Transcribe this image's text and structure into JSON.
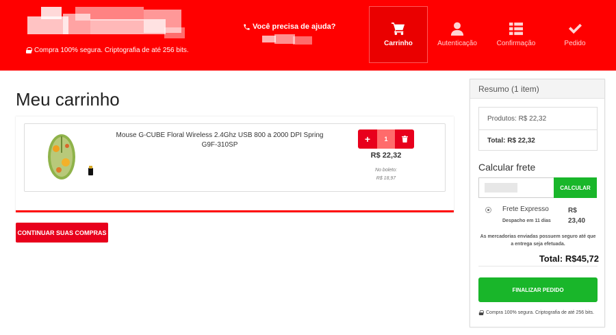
{
  "header": {
    "secure_text": "Compra 100% segura. Criptografia de até 256 bits.",
    "help_text": "Você precisa de ajuda?",
    "steps": [
      {
        "label": "Carrinho",
        "icon": "cart-icon",
        "active": true
      },
      {
        "label": "Autenticação",
        "icon": "user-icon",
        "active": false
      },
      {
        "label": "Confirmação",
        "icon": "list-icon",
        "active": false
      },
      {
        "label": "Pedido",
        "icon": "check-icon",
        "active": false
      }
    ]
  },
  "main": {
    "title": "Meu carrinho",
    "item": {
      "name": "Mouse G-CUBE Floral Wireless 2.4Ghz USB 800 a 2000 DPI Spring G9F-310SP",
      "quantity": "1",
      "price": "R$ 22,32",
      "boleto_label": "No boleto:",
      "boleto_price": "R$ 18,97"
    },
    "continue_label": "CONTINUAR SUAS COMPRAS"
  },
  "summary": {
    "heading": "Resumo (1 item)",
    "products": "Produtos: R$ 22,32",
    "total_line": "Total: R$ 22,32",
    "shipping_title": "Calcular frete",
    "calc_label": "CALCULAR",
    "shipping_option": {
      "name": "Frete Expresso",
      "eta": "Despacho em 11 dias",
      "price": "R$ 23,40"
    },
    "note": "As mercadorias enviadas possuem seguro até que a entrega seja efetuada.",
    "grand_total": "Total: R$45,72",
    "finish_label": "FINALIZAR PEDIDO",
    "secure_text": "Compra 100% segura. Criptografia de até 256 bits."
  },
  "colors": {
    "brand_red": "#ff0000",
    "button_red": "#e8001c",
    "button_green": "#19b62a"
  }
}
